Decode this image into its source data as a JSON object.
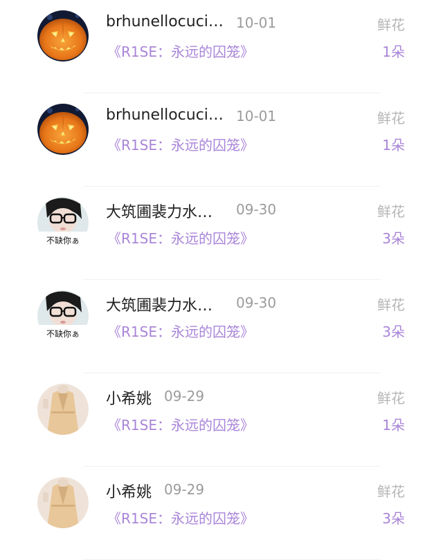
{
  "records": [
    {
      "avatar": "pumpkin-avatar",
      "name": "brhunellocuci…",
      "date": "10-01",
      "gift": "鲜花",
      "work": "《R1SE：永远的囚笼》",
      "count": "1朵"
    },
    {
      "avatar": "pumpkin-avatar",
      "name": "brhunellocuci…",
      "date": "10-01",
      "gift": "鲜花",
      "work": "《R1SE：永远的囚笼》",
      "count": "1朵"
    },
    {
      "avatar": "glasses-avatar",
      "avatar_text": "不缺你ぁ",
      "name": "大筑圃裴力水…",
      "date": "09-30",
      "gift": "鲜花",
      "work": "《R1SE：永远的囚笼》",
      "count": "3朵"
    },
    {
      "avatar": "glasses-avatar",
      "avatar_text": "不缺你ぁ",
      "name": "大筑圃裴力水…",
      "date": "09-30",
      "gift": "鲜花",
      "work": "《R1SE：永远的囚笼》",
      "count": "3朵"
    },
    {
      "avatar": "coat-avatar",
      "name": "小希姚",
      "date": "09-29",
      "gift": "鲜花",
      "work": "《R1SE：永远的囚笼》",
      "count": "1朵"
    },
    {
      "avatar": "coat-avatar",
      "name": "小希姚",
      "date": "09-29",
      "gift": "鲜花",
      "work": "《R1SE：永远的囚笼》",
      "count": "3朵"
    }
  ],
  "colors": {
    "accent": "#a985d8",
    "name": "#222222",
    "muted": "#9b9b9b",
    "gift": "#b5b5b5"
  }
}
